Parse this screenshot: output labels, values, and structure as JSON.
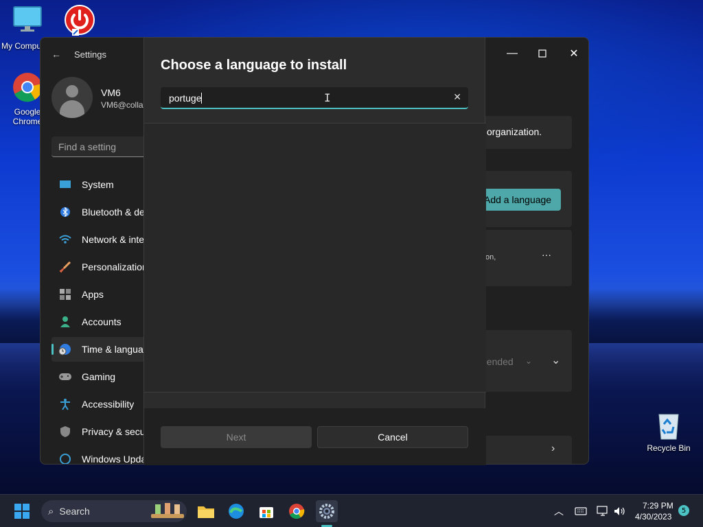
{
  "desktop": {
    "icons": [
      {
        "label": "My Compu",
        "name": "my-computer"
      },
      {
        "label": "Google Chrome",
        "name": "google-chrome"
      },
      {
        "label": "Recycle Bin",
        "name": "recycle-bin"
      }
    ]
  },
  "settings": {
    "title": "Settings",
    "user": {
      "name": "VM6",
      "email": "VM6@collal"
    },
    "search_placeholder": "Find a setting",
    "nav": [
      {
        "label": "System",
        "icon": "monitor-icon"
      },
      {
        "label": "Bluetooth & de",
        "icon": "bluetooth-icon"
      },
      {
        "label": "Network & inte",
        "icon": "wifi-icon"
      },
      {
        "label": "Personalization",
        "icon": "brush-icon"
      },
      {
        "label": "Apps",
        "icon": "apps-icon"
      },
      {
        "label": "Accounts",
        "icon": "person-icon"
      },
      {
        "label": "Time & langua",
        "icon": "globe-clock-icon",
        "active": true
      },
      {
        "label": "Gaming",
        "icon": "gamepad-icon"
      },
      {
        "label": "Accessibility",
        "icon": "accessibility-icon"
      },
      {
        "label": "Privacy & secu",
        "icon": "shield-icon"
      },
      {
        "label": "Windows Upda",
        "icon": "update-icon"
      }
    ],
    "content": {
      "org_text": "organization.",
      "add_language_label": "Add a language",
      "lang_card_fragment": "on,",
      "more_label": "···",
      "recommended_fragment": "nended"
    },
    "accent": "#4cc2c4"
  },
  "dialog": {
    "title": "Choose a language to install",
    "search_value": "portuge",
    "clear_label": "✕",
    "next_label": "Next",
    "cancel_label": "Cancel"
  },
  "taskbar": {
    "search_label": "Search",
    "time": "7:29 PM",
    "date": "4/30/2023",
    "notification_count": "5"
  }
}
